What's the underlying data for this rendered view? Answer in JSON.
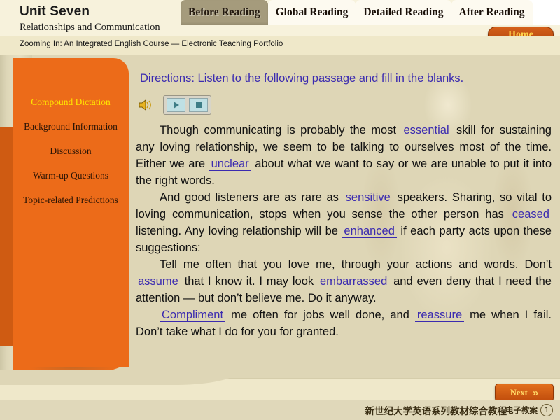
{
  "header": {
    "unit_title": "Unit Seven",
    "unit_subtitle": "Relationships and Communication",
    "home_label": "Home",
    "course_line": "Zooming In: An Integrated English Course — Electronic Teaching Portfolio",
    "tabs": [
      {
        "label": "Before Reading",
        "active": true
      },
      {
        "label": "Global Reading",
        "active": false
      },
      {
        "label": "Detailed Reading",
        "active": false
      },
      {
        "label": "After Reading",
        "active": false
      }
    ]
  },
  "sidebar": {
    "items": [
      {
        "label": "Compound Dictation",
        "active": true
      },
      {
        "label": "Background Information",
        "active": false
      },
      {
        "label": "Discussion",
        "active": false
      },
      {
        "label": "Warm-up Questions",
        "active": false
      },
      {
        "label": "Topic-related Predictions",
        "active": false
      }
    ]
  },
  "main": {
    "directions": "Directions: Listen to the following passage and fill in the blanks.",
    "audio": {
      "speaker_icon": "speaker-icon",
      "play_icon": "play-icon",
      "stop_icon": "stop-icon"
    },
    "paragraphs": [
      {
        "parts": [
          {
            "t": "text",
            "v": "Though communicating is probably the most "
          },
          {
            "t": "blank",
            "v": "essential"
          },
          {
            "t": "text",
            "v": " skill for sustaining any loving relationship, we seem to be talking to ourselves most of the time. Either we are "
          },
          {
            "t": "blank",
            "v": "unclear"
          },
          {
            "t": "text",
            "v": " about what we want to say or we are unable to put it into the right words."
          }
        ]
      },
      {
        "parts": [
          {
            "t": "text",
            "v": "And good listeners are as rare as "
          },
          {
            "t": "blank",
            "v": "sensitive"
          },
          {
            "t": "text",
            "v": " speakers. Sharing, so vital to loving communication, stops when you sense the other person has "
          },
          {
            "t": "blank",
            "v": "ceased"
          },
          {
            "t": "text",
            "v": " listening. Any loving relationship will be "
          },
          {
            "t": "blank",
            "v": "enhanced"
          },
          {
            "t": "text",
            "v": " if each party acts upon these suggestions:"
          }
        ]
      },
      {
        "parts": [
          {
            "t": "text",
            "v": "Tell me often that you love me, through your actions and words. Don’t "
          },
          {
            "t": "blank",
            "v": "assume"
          },
          {
            "t": "text",
            "v": " that I know it. I may look "
          },
          {
            "t": "blank",
            "v": "embarrassed"
          },
          {
            "t": "text",
            "v": " and even deny that I need the attention — but don’t believe me. Do it anyway."
          }
        ]
      },
      {
        "parts": [
          {
            "t": "blank",
            "v": "Compliment"
          },
          {
            "t": "text",
            "v": " me often for jobs well done, and "
          },
          {
            "t": "blank",
            "v": "reassure"
          },
          {
            "t": "text",
            "v": " me when I fail. Don’t take what I do for you for granted."
          }
        ]
      }
    ]
  },
  "footer": {
    "next_label": "Next",
    "next_chevron": "»",
    "series_title": "新世纪大学英语系列教材综合教程",
    "series_sub": "电子教案",
    "page_number": "1"
  },
  "colors": {
    "banner_orange": "#ec6b19",
    "accent_blue": "#3b2bb0",
    "active_nav_yellow": "#ffe400",
    "stage_bg": "#ded6b6",
    "header_bg": "#f7f2dc",
    "button_orange": "#c04c0c"
  }
}
